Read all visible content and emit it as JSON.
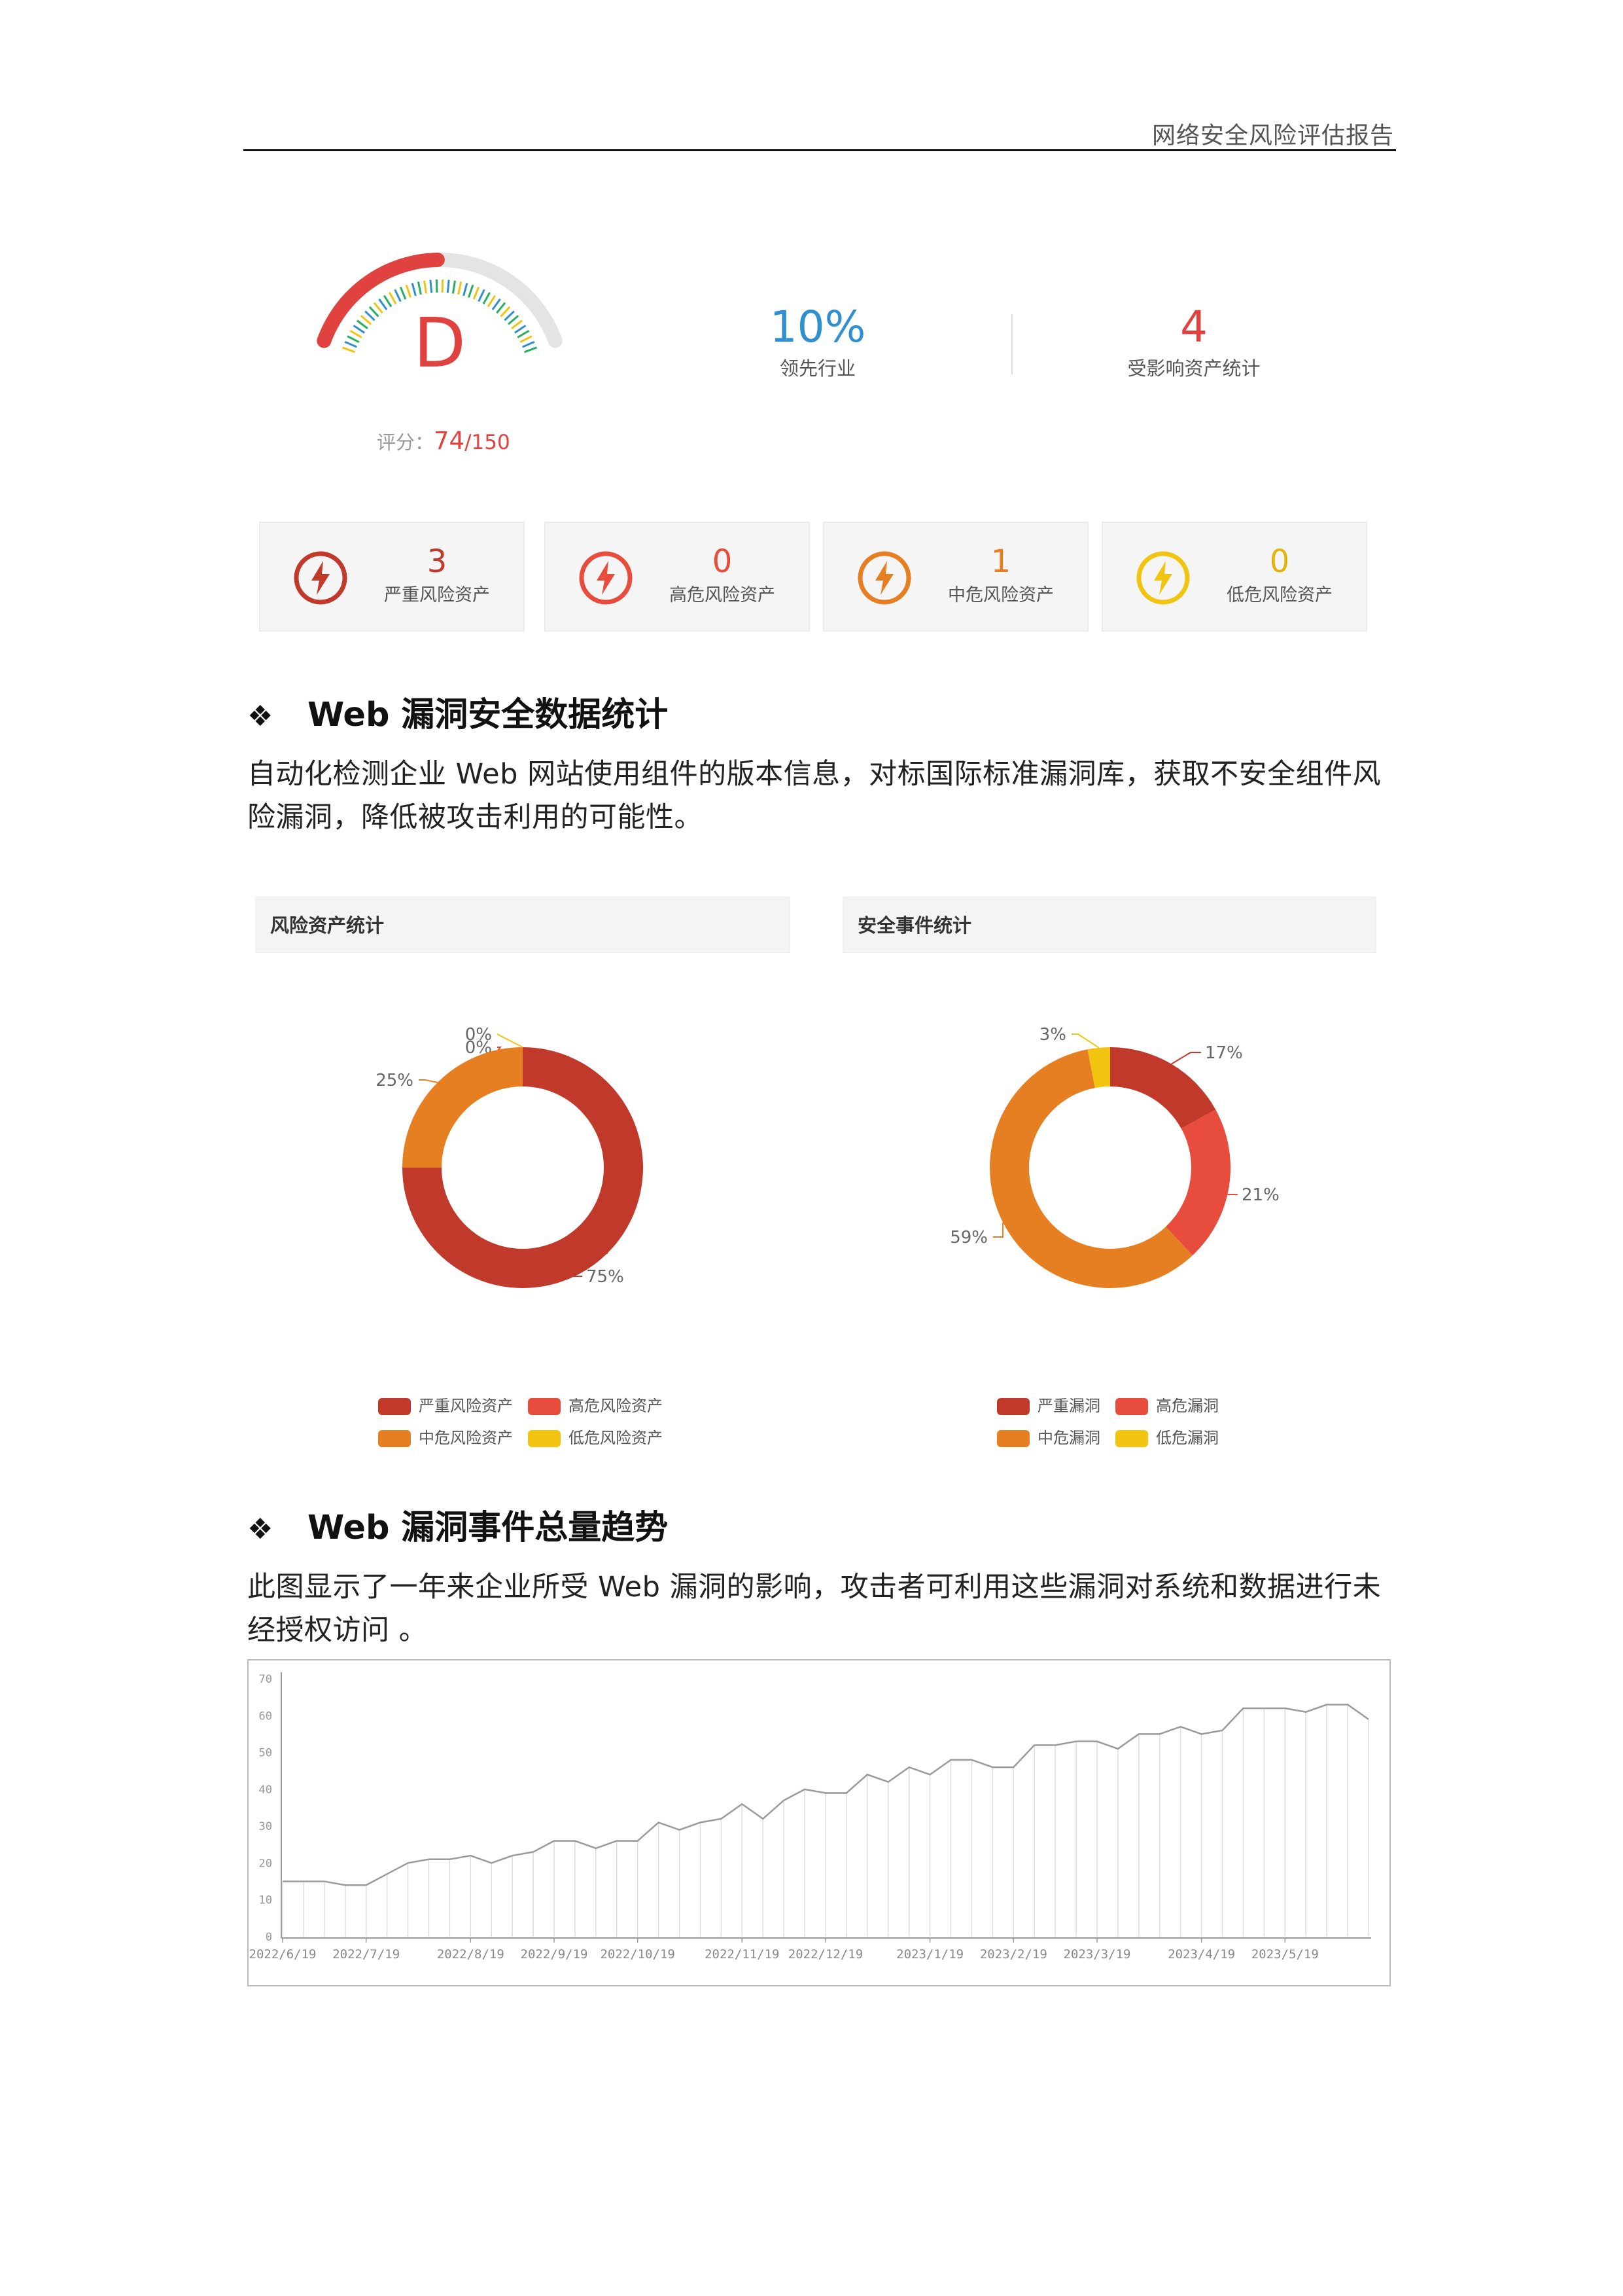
{
  "header": {
    "title": "网络安全风险评估报告"
  },
  "score": {
    "grade": "D",
    "label": "评分：",
    "value": "74",
    "total": "/150",
    "fraction": 0.4933
  },
  "stats": [
    {
      "value": "10%",
      "label": "领先行业",
      "color": "#2f8fd0"
    },
    {
      "value": "4",
      "label": "受影响资产统计",
      "color": "#e0433f"
    }
  ],
  "risk_cards": [
    {
      "value": "3",
      "label": "严重风险资产",
      "color": "#c0392b"
    },
    {
      "value": "0",
      "label": "高危风险资产",
      "color": "#e74c3c"
    },
    {
      "value": "1",
      "label": "中危风险资产",
      "color": "#e67e22"
    },
    {
      "value": "0",
      "label": "低危风险资产",
      "color": "#f1c40f"
    }
  ],
  "section1": {
    "bullet": "❖",
    "title": "Web 漏洞安全数据统计",
    "line1": "自动化检测企业 Web 网站使用组件的版本信息，对标国际标准漏洞库，获取不安全组件风",
    "line2": "险漏洞，降低被攻击利用的可能性。"
  },
  "section2": {
    "bullet": "❖",
    "title": "Web 漏洞事件总量趋势",
    "line1": "此图显示了一年来企业所受 Web 漏洞的影响，攻击者可利用这些漏洞对系统和数据进行未",
    "line2": "经授权访问 。"
  },
  "chart_data": [
    {
      "type": "pie",
      "title": "风险资产统计",
      "categories": [
        "严重风险资产",
        "高危风险资产",
        "中危风险资产",
        "低危风险资产"
      ],
      "values": [
        75,
        0,
        25,
        0
      ],
      "labels": [
        "75%",
        "0%",
        "25%",
        "0%"
      ],
      "colors": [
        "#c0392b",
        "#e74c3c",
        "#e67e22",
        "#f1c40f"
      ],
      "legend": "bottom"
    },
    {
      "type": "pie",
      "title": "安全事件统计",
      "categories": [
        "严重漏洞",
        "高危漏洞",
        "中危漏洞",
        "低危漏洞"
      ],
      "values": [
        17,
        21,
        59,
        3
      ],
      "labels": [
        "17%",
        "21%",
        "59%",
        "3%"
      ],
      "colors": [
        "#c0392b",
        "#e74c3c",
        "#e67e22",
        "#f1c40f"
      ],
      "legend": "bottom"
    },
    {
      "type": "area",
      "ylim": [
        0,
        70
      ],
      "yticks": [
        "0",
        "10",
        "20",
        "30",
        "40",
        "50",
        "60",
        "70"
      ],
      "xticks": [
        "2022/6/19",
        "2022/7/19",
        "2022/8/19",
        "2022/9/19",
        "2022/10/19",
        "2022/11/19",
        "2022/12/19",
        "2023/1/19",
        "2023/2/19",
        "2023/3/19",
        "2023/4/19",
        "2023/5/19"
      ],
      "series": [
        {
          "values": [
            15,
            15,
            15,
            14,
            14,
            17,
            20,
            21,
            21,
            22,
            20,
            22,
            23,
            26,
            26,
            24,
            26,
            26,
            31,
            29,
            31,
            32,
            36,
            32,
            37,
            40,
            39,
            39,
            44,
            42,
            46,
            44,
            48,
            48,
            46,
            46,
            52,
            52,
            53,
            53,
            51,
            55,
            55,
            57,
            55,
            56,
            62,
            62,
            62,
            61,
            63,
            63,
            59
          ]
        }
      ],
      "grid": false
    }
  ]
}
